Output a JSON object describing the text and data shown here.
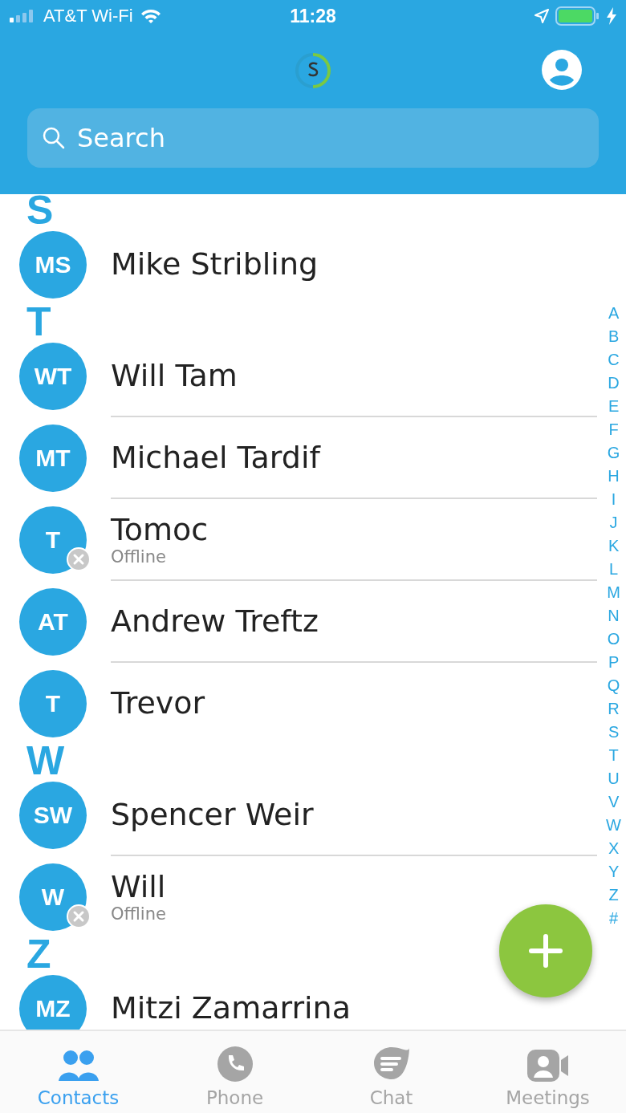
{
  "status_bar": {
    "carrier": "AT&T Wi-Fi",
    "time": "11:28"
  },
  "search": {
    "placeholder": "Search"
  },
  "sections": [
    {
      "letter": "S",
      "contacts": [
        {
          "initials": "MS",
          "name": "Mike Stribling",
          "offline": false
        }
      ]
    },
    {
      "letter": "T",
      "contacts": [
        {
          "initials": "WT",
          "name": "Will Tam",
          "offline": false
        },
        {
          "initials": "MT",
          "name": "Michael Tardif",
          "offline": false
        },
        {
          "initials": "T",
          "name": "Tomoc",
          "offline": true,
          "status": "Offline"
        },
        {
          "initials": "AT",
          "name": "Andrew Treftz",
          "offline": false
        },
        {
          "initials": "T",
          "name": "Trevor",
          "offline": false
        }
      ]
    },
    {
      "letter": "W",
      "contacts": [
        {
          "initials": "SW",
          "name": "Spencer Weir",
          "offline": false
        },
        {
          "initials": "W",
          "name": "Will",
          "offline": true,
          "status": "Offline"
        }
      ]
    },
    {
      "letter": "Z",
      "contacts": [
        {
          "initials": "MZ",
          "name": "Mitzi Zamarrina",
          "offline": false
        }
      ]
    }
  ],
  "index": [
    "A",
    "B",
    "C",
    "D",
    "E",
    "F",
    "G",
    "H",
    "I",
    "J",
    "K",
    "L",
    "M",
    "N",
    "O",
    "P",
    "Q",
    "R",
    "S",
    "T",
    "U",
    "V",
    "W",
    "X",
    "Y",
    "Z",
    "#"
  ],
  "tabs": [
    {
      "label": "Contacts",
      "kind": "contacts",
      "selected": true
    },
    {
      "label": "Phone",
      "kind": "phone",
      "selected": false
    },
    {
      "label": "Chat",
      "kind": "chat",
      "selected": false
    },
    {
      "label": "Meetings",
      "kind": "meetings",
      "selected": false
    }
  ]
}
